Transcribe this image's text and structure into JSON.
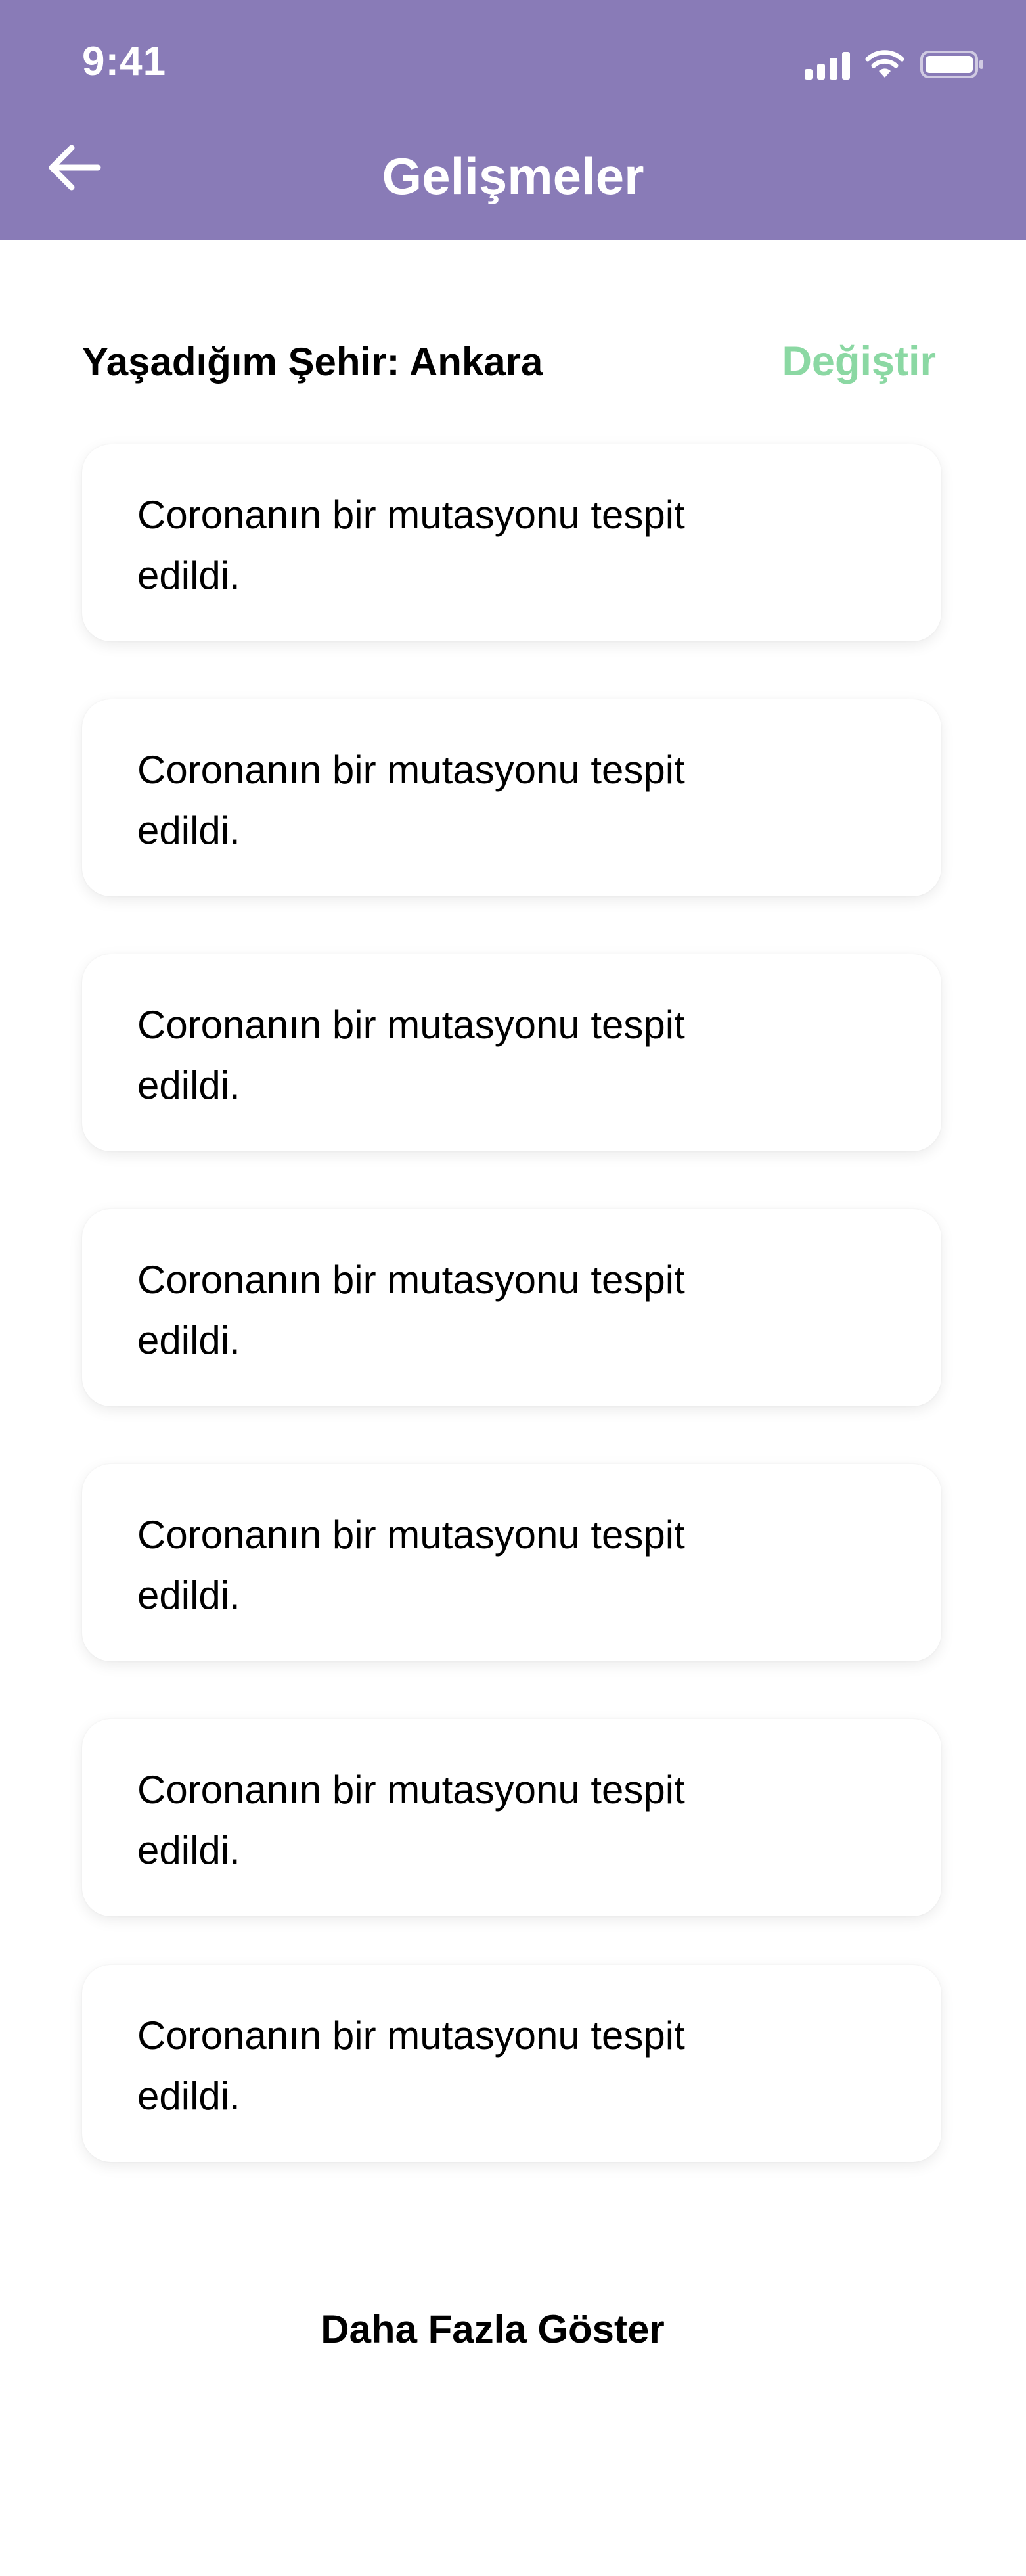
{
  "status_bar": {
    "time": "9:41"
  },
  "header": {
    "title": "Gelişmeler",
    "back_icon": "arrow-left-icon",
    "background_color": "#897bb7"
  },
  "city": {
    "label": "Yaşadığım Şehir: Ankara",
    "change_label": "Değiştir",
    "change_color": "#8bd8a3"
  },
  "news_items": [
    {
      "text": "Coronanın bir mutasyonu tespit edildi."
    },
    {
      "text": "Coronanın bir mutasyonu tespit edildi."
    },
    {
      "text": "Coronanın bir mutasyonu tespit edildi."
    },
    {
      "text": "Coronanın bir mutasyonu tespit edildi."
    },
    {
      "text": "Coronanın bir mutasyonu tespit edildi."
    },
    {
      "text": "Coronanın bir mutasyonu tespit edildi."
    },
    {
      "text": "Coronanın bir mutasyonu tespit edildi."
    }
  ],
  "footer": {
    "show_more_label": "Daha Fazla Göster"
  }
}
